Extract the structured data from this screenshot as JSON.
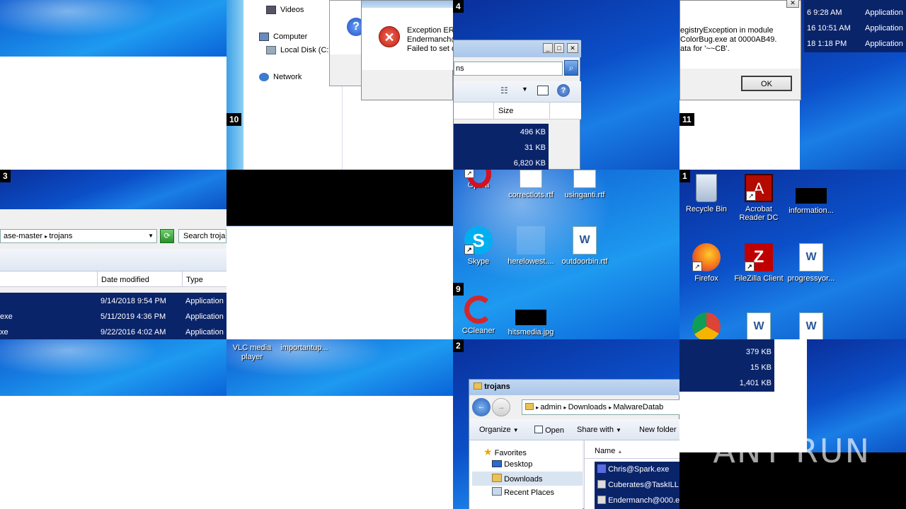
{
  "tile_numbers": {
    "t10": "10",
    "t4": "4",
    "t11": "11",
    "t3": "3",
    "t9": "9",
    "t1": "1",
    "t2": "2"
  },
  "nav_pane": {
    "videos": "Videos",
    "computer": "Computer",
    "local_disk": "Local Disk (C:)",
    "network": "Network"
  },
  "error_dialog": {
    "line1": "Exception ER",
    "line2": "Endermanch@",
    "line3": "Failed to set d"
  },
  "explorer_small": {
    "search_value": "ns",
    "col_size": "Size",
    "sizes": [
      "496 KB",
      "31 KB",
      "6,820 KB"
    ]
  },
  "registry_dialog": {
    "line1": "egistryException in module",
    "line2": "ColorBug.exe at 0000AB49.",
    "line3": "ata for '~~CB'.",
    "ok": "OK",
    "times": [
      "6 9:28 AM",
      "16 10:51 AM",
      "18 1:18 PM"
    ],
    "types": [
      "Application",
      "Application",
      "Application"
    ]
  },
  "explorer_trojans_left": {
    "breadcrumb": "ase-master",
    "folder": "trojans",
    "search_placeholder": "Search troja",
    "col_date": "Date modified",
    "col_type": "Type",
    "rows": [
      {
        "name": "",
        "date": "9/14/2018 9:54 PM",
        "type": "Application"
      },
      {
        "name": "exe",
        "date": "5/11/2019 4:36 PM",
        "type": "Application"
      },
      {
        "name": "xe",
        "date": "9/22/2016 4:02 AM",
        "type": "Application"
      }
    ]
  },
  "desktop_mid": {
    "icons": [
      "Opera",
      "correctlots.rtf",
      "usinganti.rtf",
      "Skype",
      "herelowest....",
      "outdoorbin.rtf",
      "CCleaner",
      "hitsmedia.jpg"
    ]
  },
  "desktop_right": {
    "icons": [
      "Recycle Bin",
      "Acrobat Reader DC",
      "information...",
      "Firefox",
      "FileZilla Client",
      "progressyor..."
    ]
  },
  "taskbar_desktop": {
    "vlc": "VLC media player",
    "important": "importantup..."
  },
  "explorer_trojans_main": {
    "title": "trojans",
    "path": [
      "admin",
      "Downloads",
      "MalwareDatab"
    ],
    "toolbar": [
      "Organize",
      "Open",
      "Share with",
      "New folder"
    ],
    "nav": [
      "Favorites",
      "Desktop",
      "Downloads",
      "Recent Places"
    ],
    "col_name": "Name",
    "files": [
      "Chris@Spark.exe",
      "Cuberates@TaskILL",
      "Endermanch@000.e"
    ]
  },
  "sizes_right": [
    "379 KB",
    "15 KB",
    "1,401 KB"
  ],
  "watermark": "ANY RUN",
  "colors": {
    "selection": "#0a246a",
    "win7_blue": "#0b4fc8"
  }
}
